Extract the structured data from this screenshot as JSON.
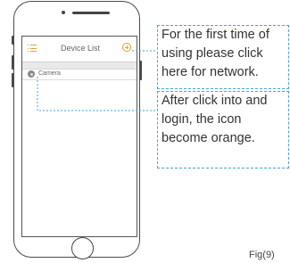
{
  "app": {
    "header_title": "Device List",
    "menu_icon": "menu-icon",
    "add_icon": "add-icon",
    "devices": [
      {
        "label": "Camera",
        "icon": "camera-icon"
      }
    ]
  },
  "callouts": {
    "network_tip": {
      "lines": [
        "For the first time of",
        "using please click",
        "here for network."
      ]
    },
    "login_tip": {
      "lines": [
        "After click into and",
        "login, the icon",
        "become orange."
      ]
    }
  },
  "figure": {
    "label": "Fig(9)"
  },
  "colors": {
    "accent": "#e89a3c",
    "callout_border": "#42a6d8",
    "outline": "#4a4a4a"
  }
}
